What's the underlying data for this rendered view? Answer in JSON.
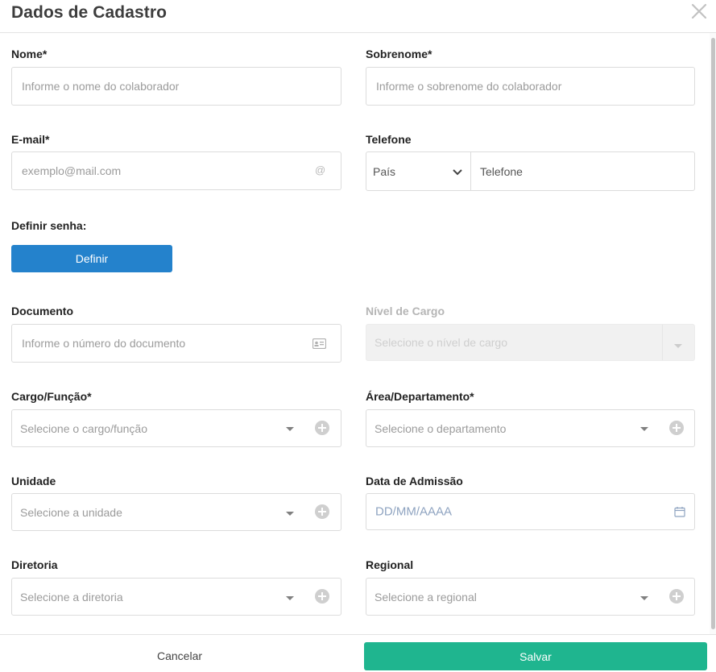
{
  "dialog": {
    "title": "Dados de Cadastro",
    "close_icon": "close-icon"
  },
  "fields": {
    "nome": {
      "label": "Nome*",
      "placeholder": "Informe o nome do colaborador"
    },
    "sobrenome": {
      "label": "Sobrenome*",
      "placeholder": "Informe o sobrenome do colaborador"
    },
    "email": {
      "label": "E-mail*",
      "placeholder": "exemplo@mail.com",
      "icon": "at-icon"
    },
    "telefone": {
      "label": "Telefone",
      "country_placeholder": "País",
      "phone_placeholder": "Telefone"
    },
    "senha": {
      "label": "Definir senha:",
      "button": "Definir"
    },
    "documento": {
      "label": "Documento",
      "placeholder": "Informe o número do documento",
      "icon": "id-card-icon"
    },
    "nivel_cargo": {
      "label": "Nível de Cargo",
      "placeholder": "Selecione o nível de cargo",
      "disabled": true
    },
    "cargo": {
      "label": "Cargo/Função*",
      "placeholder": "Selecione o cargo/função"
    },
    "area": {
      "label": "Área/Departamento*",
      "placeholder": "Selecione o departamento"
    },
    "unidade": {
      "label": "Unidade",
      "placeholder": "Selecione a unidade"
    },
    "admissao": {
      "label": "Data de Admissão",
      "placeholder": "DD/MM/AAAA",
      "icon": "calendar-icon"
    },
    "diretoria": {
      "label": "Diretoria",
      "placeholder": "Selecione a diretoria"
    },
    "regional": {
      "label": "Regional",
      "placeholder": "Selecione a regional"
    }
  },
  "footer": {
    "cancel": "Cancelar",
    "save": "Salvar"
  },
  "colors": {
    "primary_button": "#2482cc",
    "save_button": "#1fb58f"
  }
}
